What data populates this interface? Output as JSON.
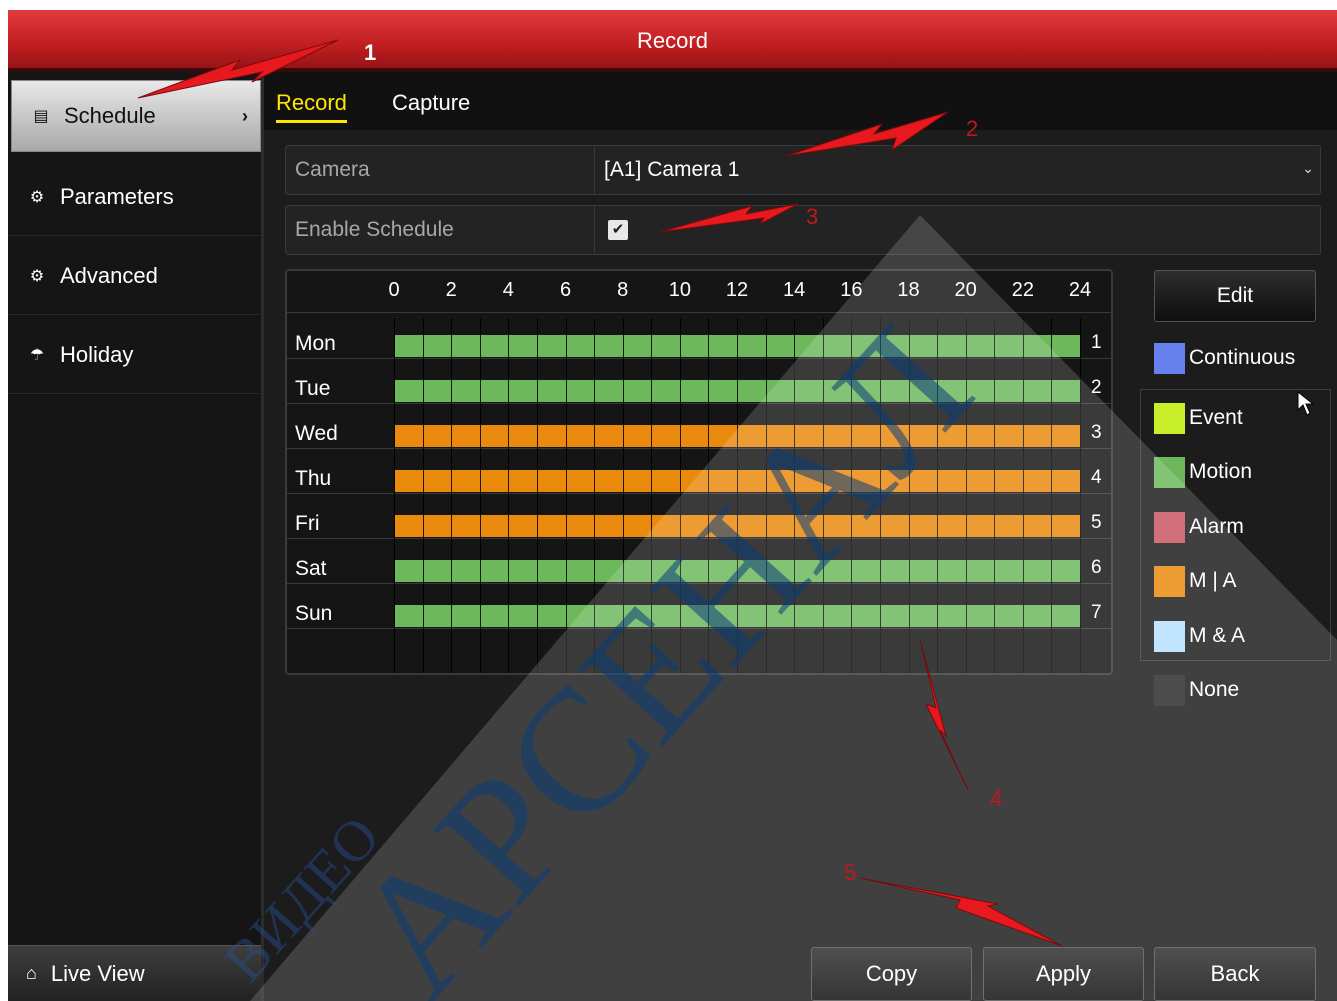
{
  "window": {
    "title": "Record"
  },
  "sidebar": {
    "items": [
      {
        "label": "Schedule",
        "icon": "calendar-icon",
        "glyph": "▤"
      },
      {
        "label": "Parameters",
        "icon": "gear-icon",
        "glyph": "⚙"
      },
      {
        "label": "Advanced",
        "icon": "gears-icon",
        "glyph": "⚙"
      },
      {
        "label": "Holiday",
        "icon": "umbrella-icon",
        "glyph": "☂"
      }
    ],
    "live_view": {
      "label": "Live View",
      "icon": "home-icon",
      "glyph": "⌂"
    }
  },
  "tabs": [
    {
      "label": "Record",
      "active": true
    },
    {
      "label": "Capture",
      "active": false
    }
  ],
  "camera": {
    "label": "Camera",
    "value": "[A1] Camera 1"
  },
  "enable_schedule": {
    "label": "Enable Schedule",
    "checked": true,
    "mark": "✔"
  },
  "schedule": {
    "hour_labels": [
      "0",
      "2",
      "4",
      "6",
      "8",
      "10",
      "12",
      "14",
      "16",
      "18",
      "20",
      "22",
      "24"
    ],
    "days": [
      {
        "name": "Mon",
        "num": "1",
        "type": "Motion",
        "start": 0,
        "end": 24
      },
      {
        "name": "Tue",
        "num": "2",
        "type": "Motion",
        "start": 0,
        "end": 24
      },
      {
        "name": "Wed",
        "num": "3",
        "type": "M | A",
        "start": 0,
        "end": 24
      },
      {
        "name": "Thu",
        "num": "4",
        "type": "M | A",
        "start": 0,
        "end": 24
      },
      {
        "name": "Fri",
        "num": "5",
        "type": "M | A",
        "start": 0,
        "end": 24
      },
      {
        "name": "Sat",
        "num": "6",
        "type": "Motion",
        "start": 0,
        "end": 24
      },
      {
        "name": "Sun",
        "num": "7",
        "type": "Motion",
        "start": 0,
        "end": 24
      }
    ]
  },
  "edit_label": "Edit",
  "legend": [
    {
      "label": "Continuous",
      "color": "#6680ee"
    },
    {
      "label": "Event",
      "color": "#c9ef2a"
    },
    {
      "label": "Motion",
      "color": "#6cb85b"
    },
    {
      "label": "Alarm",
      "color": "#c95561"
    },
    {
      "label": "M | A",
      "color": "#e98a0d"
    },
    {
      "label": "M & A",
      "color": "#b7e0ff"
    },
    {
      "label": "None",
      "color": "#2a2a2a"
    }
  ],
  "buttons": {
    "copy": "Copy",
    "apply": "Apply",
    "back": "Back"
  },
  "annotations": [
    "1",
    "2",
    "3",
    "4",
    "5"
  ],
  "watermark": {
    "line1": "ВИДЕО",
    "line2": "АРСЕНАЛ"
  },
  "colors": {
    "accent": "#ffe500",
    "titlebar": "#c11f22",
    "arrow": "#e8191e"
  }
}
